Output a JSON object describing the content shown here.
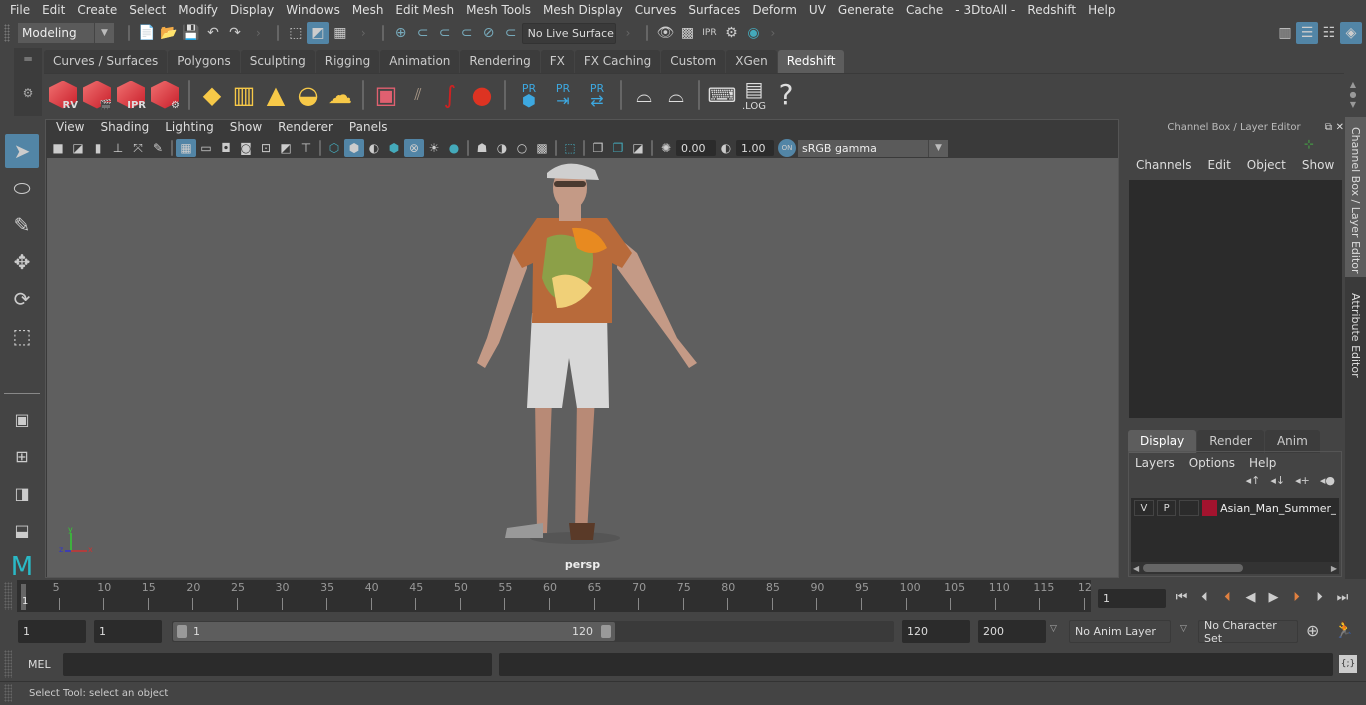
{
  "menubar": [
    "File",
    "Edit",
    "Create",
    "Select",
    "Modify",
    "Display",
    "Windows",
    "Mesh",
    "Edit Mesh",
    "Mesh Tools",
    "Mesh Display",
    "Curves",
    "Surfaces",
    "Deform",
    "UV",
    "Generate",
    "Cache",
    "- 3DtoAll -",
    "Redshift",
    "Help"
  ],
  "statusline": {
    "workspace": "Modeling",
    "live_surface": "No Live Surface"
  },
  "shelf": {
    "tabs": [
      "Curves / Surfaces",
      "Polygons",
      "Sculpting",
      "Rigging",
      "Animation",
      "Rendering",
      "FX",
      "FX Caching",
      "Custom",
      "XGen",
      "Redshift"
    ],
    "active_tab": "Redshift",
    "redshift_icons": [
      {
        "name": "render-view-icon",
        "label": "RV"
      },
      {
        "name": "batch-render-icon",
        "label": ""
      },
      {
        "name": "ipr-icon",
        "label": "IPR"
      },
      {
        "name": "render-settings-icon",
        "label": ""
      }
    ],
    "pr_icons": [
      {
        "name": "proxy-export-icon",
        "label": "PR"
      },
      {
        "name": "proxy-import-icon",
        "label": "PR"
      },
      {
        "name": "proxy-convert-icon",
        "label": "PR"
      }
    ],
    "log_label": ".LOG",
    "help_label": "?"
  },
  "viewport": {
    "menus": [
      "View",
      "Shading",
      "Lighting",
      "Show",
      "Renderer",
      "Panels"
    ],
    "exposure": "0.00",
    "gamma": "1.00",
    "colorspace": "sRGB gamma",
    "color_mgmt_label": "ON",
    "camera_label": "persp",
    "axis": {
      "x": "x",
      "y": "y",
      "z": "z"
    }
  },
  "channel_box": {
    "title": "Channel Box / Layer Editor",
    "menus": [
      "Channels",
      "Edit",
      "Object",
      "Show"
    ],
    "layer_tabs": [
      "Display",
      "Render",
      "Anim"
    ],
    "active_layer_tab": "Display",
    "layer_menus": [
      "Layers",
      "Options",
      "Help"
    ],
    "layers": [
      {
        "v": "V",
        "p": "P",
        "color": "#a3132e",
        "name": "Asian_Man_Summer_C"
      }
    ]
  },
  "side_tabs": [
    "Channel Box / Layer Editor",
    "Attribute Editor"
  ],
  "timeline": {
    "ticks": [
      "5",
      "10",
      "15",
      "20",
      "25",
      "30",
      "35",
      "40",
      "45",
      "50",
      "55",
      "60",
      "65",
      "70",
      "75",
      "80",
      "85",
      "90",
      "95",
      "100",
      "105",
      "110",
      "115",
      "12"
    ],
    "current_marker": "1",
    "current_frame": "1"
  },
  "range": {
    "start": "1",
    "playback_start": "1",
    "slider_start": "1",
    "slider_end": "120",
    "playback_end": "120",
    "end": "200",
    "anim_layer": "No Anim Layer",
    "character_set": "No Character Set"
  },
  "command_line": {
    "lang": "MEL",
    "input": "",
    "output": ""
  },
  "help_line": "Select Tool: select an object"
}
